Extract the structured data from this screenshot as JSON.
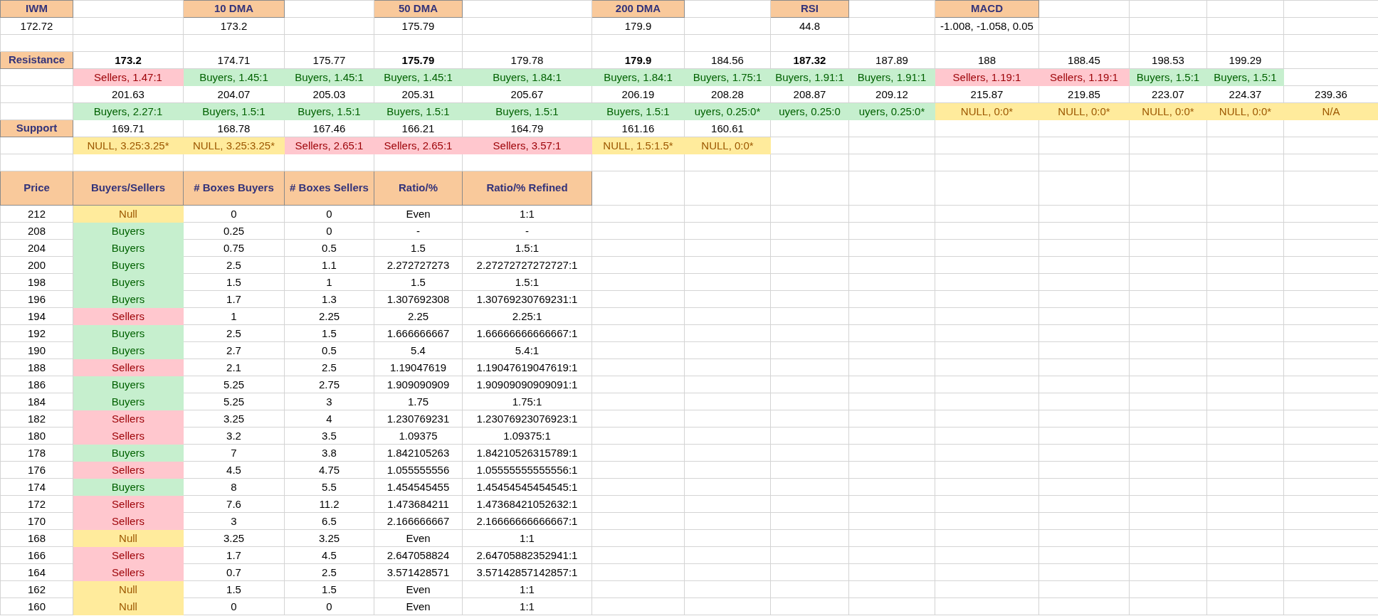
{
  "indicators": [
    {
      "label": "IWM",
      "value": "172.72"
    },
    {
      "label": "10 DMA",
      "value": "173.2"
    },
    {
      "label": "50 DMA",
      "value": "175.79"
    },
    {
      "label": "200 DMA",
      "value": "179.9"
    },
    {
      "label": "RSI",
      "value": "44.8"
    },
    {
      "label": "MACD",
      "value": "-1.008, -1.058, 0.05"
    }
  ],
  "resistance": {
    "label": "Resistance",
    "rows": [
      [
        {
          "price": "173.2",
          "bold": true,
          "kind": "sellers",
          "signal": "Sellers, 1.47:1"
        },
        {
          "price": "174.71",
          "bold": false,
          "kind": "buyers",
          "signal": "Buyers, 1.45:1"
        },
        {
          "price": "175.77",
          "bold": false,
          "kind": "buyers",
          "signal": "Buyers, 1.45:1"
        },
        {
          "price": "175.79",
          "bold": true,
          "kind": "buyers",
          "signal": "Buyers, 1.45:1"
        },
        {
          "price": "179.78",
          "bold": false,
          "kind": "buyers",
          "signal": "Buyers, 1.84:1"
        },
        {
          "price": "179.9",
          "bold": true,
          "kind": "buyers",
          "signal": "Buyers, 1.84:1"
        },
        {
          "price": "184.56",
          "bold": false,
          "kind": "buyers",
          "signal": "Buyers, 1.75:1"
        },
        {
          "price": "187.32",
          "bold": true,
          "kind": "buyers",
          "signal": "Buyers, 1.91:1"
        },
        {
          "price": "187.89",
          "bold": false,
          "kind": "buyers",
          "signal": "Buyers, 1.91:1"
        },
        {
          "price": "188",
          "bold": false,
          "kind": "sellers",
          "signal": "Sellers, 1.19:1"
        },
        {
          "price": "188.45",
          "bold": false,
          "kind": "sellers",
          "signal": "Sellers, 1.19:1"
        },
        {
          "price": "198.53",
          "bold": false,
          "kind": "buyers",
          "signal": "Buyers, 1.5:1"
        },
        {
          "price": "199.29",
          "bold": false,
          "kind": "buyers",
          "signal": "Buyers, 1.5:1"
        }
      ],
      [
        {
          "price": "201.63",
          "bold": false,
          "kind": "buyers",
          "signal": "Buyers, 2.27:1"
        },
        {
          "price": "204.07",
          "bold": false,
          "kind": "buyers",
          "signal": "Buyers, 1.5:1"
        },
        {
          "price": "205.03",
          "bold": false,
          "kind": "buyers",
          "signal": "Buyers, 1.5:1"
        },
        {
          "price": "205.31",
          "bold": false,
          "kind": "buyers",
          "signal": "Buyers, 1.5:1"
        },
        {
          "price": "205.67",
          "bold": false,
          "kind": "buyers",
          "signal": "Buyers, 1.5:1"
        },
        {
          "price": "206.19",
          "bold": false,
          "kind": "buyers",
          "signal": "Buyers, 1.5:1"
        },
        {
          "price": "208.28",
          "bold": false,
          "kind": "buyers",
          "signal": "uyers, 0.25:0*"
        },
        {
          "price": "208.87",
          "bold": false,
          "kind": "buyers",
          "signal": "uyers, 0.25:0"
        },
        {
          "price": "209.12",
          "bold": false,
          "kind": "buyers",
          "signal": "uyers, 0.25:0*"
        },
        {
          "price": "215.87",
          "bold": false,
          "kind": "null",
          "signal": "NULL, 0:0*"
        },
        {
          "price": "219.85",
          "bold": false,
          "kind": "null",
          "signal": "NULL, 0:0*"
        },
        {
          "price": "223.07",
          "bold": false,
          "kind": "null",
          "signal": "NULL, 0:0*"
        },
        {
          "price": "224.37",
          "bold": false,
          "kind": "null",
          "signal": "NULL, 0:0*"
        },
        {
          "price": "239.36",
          "bold": false,
          "kind": "null",
          "signal": "N/A"
        }
      ]
    ]
  },
  "support": {
    "label": "Support",
    "rows": [
      [
        {
          "price": "169.71",
          "bold": false,
          "kind": "null",
          "signal": "NULL, 3.25:3.25*"
        },
        {
          "price": "168.78",
          "bold": false,
          "kind": "null",
          "signal": "NULL, 3.25:3.25*"
        },
        {
          "price": "167.46",
          "bold": false,
          "kind": "sellers",
          "signal": "Sellers, 2.65:1"
        },
        {
          "price": "166.21",
          "bold": false,
          "kind": "sellers",
          "signal": "Sellers, 2.65:1"
        },
        {
          "price": "164.79",
          "bold": false,
          "kind": "sellers",
          "signal": "Sellers, 3.57:1"
        },
        {
          "price": "161.16",
          "bold": false,
          "kind": "null",
          "signal": "NULL, 1.5:1.5*"
        },
        {
          "price": "160.61",
          "bold": false,
          "kind": "null",
          "signal": "NULL, 0:0*"
        }
      ]
    ]
  },
  "price_table": {
    "columns": [
      "Price",
      "Buyers/Sellers",
      "# Boxes Buyers",
      "# Boxes Sellers",
      "Ratio/%",
      "Ratio/% Refined"
    ],
    "rows": [
      {
        "price": "212",
        "kind": "null",
        "status": "Null",
        "boxes_buyers": "0",
        "boxes_sellers": "0",
        "ratio": "Even",
        "ratio_refined": "1:1"
      },
      {
        "price": "208",
        "kind": "buyers",
        "status": "Buyers",
        "boxes_buyers": "0.25",
        "boxes_sellers": "0",
        "ratio": "-",
        "ratio_refined": "-"
      },
      {
        "price": "204",
        "kind": "buyers",
        "status": "Buyers",
        "boxes_buyers": "0.75",
        "boxes_sellers": "0.5",
        "ratio": "1.5",
        "ratio_refined": "1.5:1"
      },
      {
        "price": "200",
        "kind": "buyers",
        "status": "Buyers",
        "boxes_buyers": "2.5",
        "boxes_sellers": "1.1",
        "ratio": "2.272727273",
        "ratio_refined": "2.27272727272727:1"
      },
      {
        "price": "198",
        "kind": "buyers",
        "status": "Buyers",
        "boxes_buyers": "1.5",
        "boxes_sellers": "1",
        "ratio": "1.5",
        "ratio_refined": "1.5:1"
      },
      {
        "price": "196",
        "kind": "buyers",
        "status": "Buyers",
        "boxes_buyers": "1.7",
        "boxes_sellers": "1.3",
        "ratio": "1.307692308",
        "ratio_refined": "1.30769230769231:1"
      },
      {
        "price": "194",
        "kind": "sellers",
        "status": "Sellers",
        "boxes_buyers": "1",
        "boxes_sellers": "2.25",
        "ratio": "2.25",
        "ratio_refined": "2.25:1"
      },
      {
        "price": "192",
        "kind": "buyers",
        "status": "Buyers",
        "boxes_buyers": "2.5",
        "boxes_sellers": "1.5",
        "ratio": "1.666666667",
        "ratio_refined": "1.66666666666667:1"
      },
      {
        "price": "190",
        "kind": "buyers",
        "status": "Buyers",
        "boxes_buyers": "2.7",
        "boxes_sellers": "0.5",
        "ratio": "5.4",
        "ratio_refined": "5.4:1"
      },
      {
        "price": "188",
        "kind": "sellers",
        "status": "Sellers",
        "boxes_buyers": "2.1",
        "boxes_sellers": "2.5",
        "ratio": "1.19047619",
        "ratio_refined": "1.19047619047619:1"
      },
      {
        "price": "186",
        "kind": "buyers",
        "status": "Buyers",
        "boxes_buyers": "5.25",
        "boxes_sellers": "2.75",
        "ratio": "1.909090909",
        "ratio_refined": "1.90909090909091:1"
      },
      {
        "price": "184",
        "kind": "buyers",
        "status": "Buyers",
        "boxes_buyers": "5.25",
        "boxes_sellers": "3",
        "ratio": "1.75",
        "ratio_refined": "1.75:1"
      },
      {
        "price": "182",
        "kind": "sellers",
        "status": "Sellers",
        "boxes_buyers": "3.25",
        "boxes_sellers": "4",
        "ratio": "1.230769231",
        "ratio_refined": "1.23076923076923:1"
      },
      {
        "price": "180",
        "kind": "sellers",
        "status": "Sellers",
        "boxes_buyers": "3.2",
        "boxes_sellers": "3.5",
        "ratio": "1.09375",
        "ratio_refined": "1.09375:1"
      },
      {
        "price": "178",
        "kind": "buyers",
        "status": "Buyers",
        "boxes_buyers": "7",
        "boxes_sellers": "3.8",
        "ratio": "1.842105263",
        "ratio_refined": "1.84210526315789:1"
      },
      {
        "price": "176",
        "kind": "sellers",
        "status": "Sellers",
        "boxes_buyers": "4.5",
        "boxes_sellers": "4.75",
        "ratio": "1.055555556",
        "ratio_refined": "1.05555555555556:1"
      },
      {
        "price": "174",
        "kind": "buyers",
        "status": "Buyers",
        "boxes_buyers": "8",
        "boxes_sellers": "5.5",
        "ratio": "1.454545455",
        "ratio_refined": "1.45454545454545:1"
      },
      {
        "price": "172",
        "kind": "sellers",
        "status": "Sellers",
        "boxes_buyers": "7.6",
        "boxes_sellers": "11.2",
        "ratio": "1.473684211",
        "ratio_refined": "1.47368421052632:1"
      },
      {
        "price": "170",
        "kind": "sellers",
        "status": "Sellers",
        "boxes_buyers": "3",
        "boxes_sellers": "6.5",
        "ratio": "2.166666667",
        "ratio_refined": "2.16666666666667:1"
      },
      {
        "price": "168",
        "kind": "null",
        "status": "Null",
        "boxes_buyers": "3.25",
        "boxes_sellers": "3.25",
        "ratio": "Even",
        "ratio_refined": "1:1"
      },
      {
        "price": "166",
        "kind": "sellers",
        "status": "Sellers",
        "boxes_buyers": "1.7",
        "boxes_sellers": "4.5",
        "ratio": "2.647058824",
        "ratio_refined": "2.64705882352941:1"
      },
      {
        "price": "164",
        "kind": "sellers",
        "status": "Sellers",
        "boxes_buyers": "0.7",
        "boxes_sellers": "2.5",
        "ratio": "3.571428571",
        "ratio_refined": "3.57142857142857:1"
      },
      {
        "price": "162",
        "kind": "null",
        "status": "Null",
        "boxes_buyers": "1.5",
        "boxes_sellers": "1.5",
        "ratio": "Even",
        "ratio_refined": "1:1"
      },
      {
        "price": "160",
        "kind": "null",
        "status": "Null",
        "boxes_buyers": "0",
        "boxes_sellers": "0",
        "ratio": "Even",
        "ratio_refined": "1:1"
      }
    ]
  }
}
